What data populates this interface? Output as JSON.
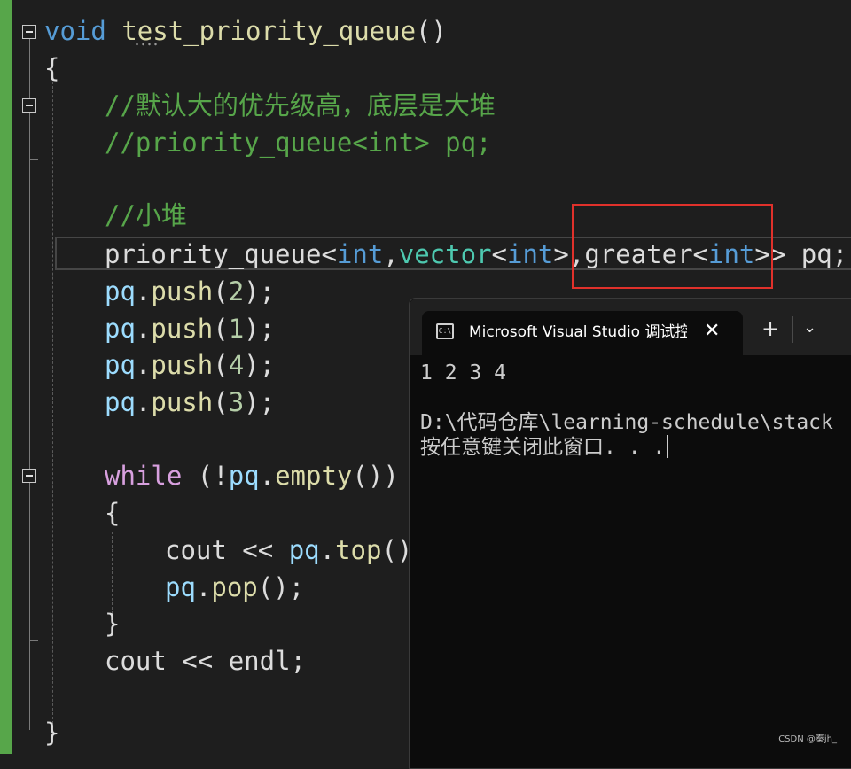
{
  "code": {
    "l1": {
      "kw": "void",
      "fn": "test_priority_queue",
      "paren": "()"
    },
    "l2": "{",
    "l3": "//默认大的优先级高，底层是大堆",
    "l4": "//priority_queue<int> pq;",
    "l6": "//小堆",
    "l7": {
      "t1": "priority_queue",
      "p1": "<",
      "t2": "int",
      "p2": ",",
      "t3": "vector",
      "p3": "<",
      "t4": "int",
      "p4": ">,",
      "t5": "greater",
      "p5": "<",
      "t6": "int",
      "p6": ">>",
      "rest": " pq;"
    },
    "push_lines": [
      {
        "obj": "pq",
        "dot": ".",
        "fn": "push",
        "open": "(",
        "num": "2",
        "close": ");"
      },
      {
        "obj": "pq",
        "dot": ".",
        "fn": "push",
        "open": "(",
        "num": "1",
        "close": ");"
      },
      {
        "obj": "pq",
        "dot": ".",
        "fn": "push",
        "open": "(",
        "num": "4",
        "close": ");"
      },
      {
        "obj": "pq",
        "dot": ".",
        "fn": "push",
        "open": "(",
        "num": "3",
        "close": ");"
      }
    ],
    "l13": {
      "kw": "while",
      "p1": " (!",
      "obj": "pq",
      "dot": ".",
      "fn": "empty",
      "p2": "())"
    },
    "l14": "{",
    "l15": {
      "kw": "cout",
      "op": " << ",
      "obj": "pq",
      "dot": ".",
      "fn": "top",
      "p": "()"
    },
    "l16": {
      "obj": "pq",
      "dot": ".",
      "fn": "pop",
      "p": "();"
    },
    "l17": "}",
    "l18": {
      "kw": "cout",
      "op": " << ",
      "fn": "endl",
      "p": ";"
    },
    "l20": "}"
  },
  "terminal": {
    "icon_text": "C:\\",
    "tab_title": "Microsoft Visual Studio 调试控制台",
    "close": "✕",
    "new_tab": "+",
    "dropdown": "⌄",
    "output_line1": "1 2 3 4",
    "output_line2": "D:\\代码仓库\\learning-schedule\\stack",
    "output_line3": "按任意键关闭此窗口. . ."
  },
  "watermark": "CSDN @秦jh_",
  "colors": {
    "keyword": "#569cd6",
    "function": "#dcdcaa",
    "variable": "#9cdcfe",
    "type": "#4ec9b0",
    "comment": "#57a64a",
    "control": "#d8a0df",
    "number": "#b5cea8",
    "highlight_box": "#e0312b"
  }
}
